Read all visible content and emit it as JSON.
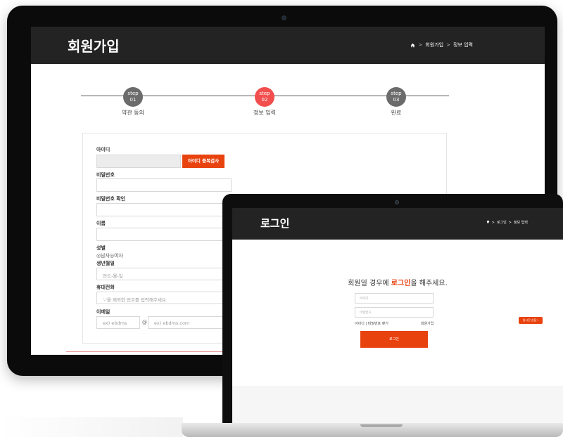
{
  "desktop": {
    "title": "회원가입",
    "breadcrumb": {
      "sep1": ">",
      "item1": "회원가입",
      "sep2": ">",
      "item2": "정보 입력"
    },
    "steps": [
      {
        "line1": "step",
        "line2": "01",
        "label": "약관 동의",
        "color": "#6b6b6b"
      },
      {
        "line1": "step",
        "line2": "02",
        "label": "정보 입력",
        "color": "#f24e4e"
      },
      {
        "line1": "step",
        "line2": "03",
        "label": "완료",
        "color": "#6b6b6b"
      }
    ],
    "form": {
      "id_label": "아이디",
      "id_check_button": "아이디 중복검사",
      "password_label": "비밀번호",
      "password_confirm_label": "비밀번호 확인",
      "name_label": "이름",
      "gender_label": "성별",
      "gender_options": "◎남자◎여자",
      "birth_label": "생년월일",
      "birth_placeholder": "연도-월-일",
      "phone_label": "휴대전화",
      "phone_placeholder": "'-'을 제외한 번호를 입력해주세요.",
      "email_label": "이메일",
      "email_local_placeholder": "ex) ebdms",
      "email_at": "@",
      "email_domain_placeholder": "ex) ebdms.com"
    }
  },
  "laptop": {
    "title": "로그인",
    "breadcrumb": {
      "sep1": ">",
      "item1": "로그인",
      "sep2": ">",
      "item2": "정보 입력"
    },
    "heading_before": "회원일 경우에 ",
    "heading_highlight": "로그인",
    "heading_after": "을 해주세요.",
    "id_placeholder": "아이디",
    "password_placeholder": "비밀번호",
    "find_link": "아이디 | 비밀번호 찾기",
    "signup_link": "회원가입",
    "login_button": "로그인",
    "consult_badge": "실시간 상담 ›"
  },
  "colors": {
    "accent": "#e8420e",
    "header": "#232323"
  }
}
